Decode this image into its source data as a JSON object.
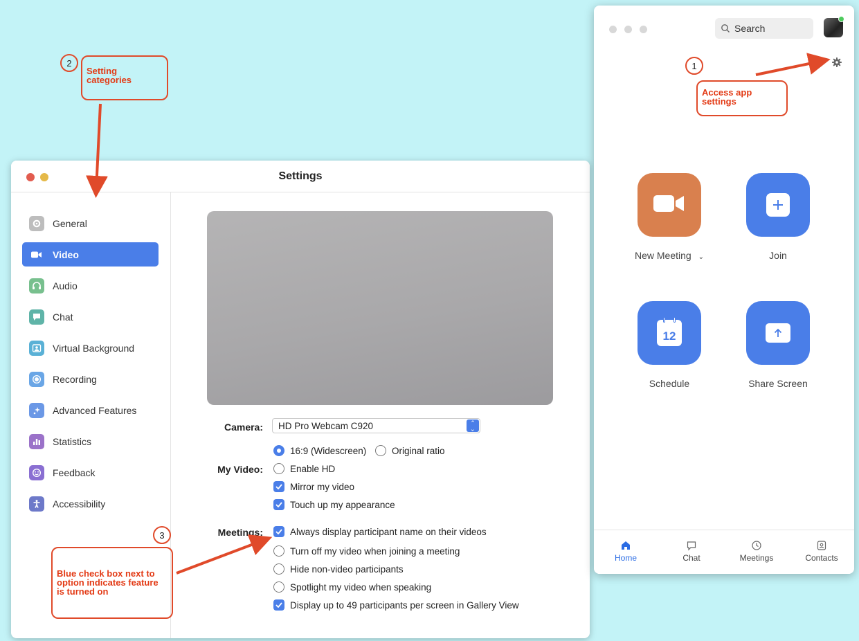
{
  "settings": {
    "title": "Settings",
    "sidebar": [
      {
        "label": "General",
        "icon": "gear-icon",
        "color": "#b9b9b9"
      },
      {
        "label": "Video",
        "icon": "video-camera-icon",
        "color": "#4a7ee8",
        "active": true
      },
      {
        "label": "Audio",
        "icon": "headphones-icon",
        "color": "#73bd8b"
      },
      {
        "label": "Chat",
        "icon": "chat-bubble-icon",
        "color": "#5fb4a8"
      },
      {
        "label": "Virtual Background",
        "icon": "person-background-icon",
        "color": "#5ab1d6"
      },
      {
        "label": "Recording",
        "icon": "record-icon",
        "color": "#6aa6e6"
      },
      {
        "label": "Advanced Features",
        "icon": "sparkle-icon",
        "color": "#6b98e6"
      },
      {
        "label": "Statistics",
        "icon": "bar-chart-icon",
        "color": "#9b72c9"
      },
      {
        "label": "Feedback",
        "icon": "smiley-icon",
        "color": "#8a6fd2"
      },
      {
        "label": "Accessibility",
        "icon": "accessibility-icon",
        "color": "#6d79c9"
      }
    ],
    "camera_label": "Camera:",
    "camera_value": "HD Pro Webcam C920",
    "my_video_label": "My Video:",
    "meetings_label": "Meetings:",
    "ratio": {
      "widescreen": "16:9 (Widescreen)",
      "original": "Original ratio"
    },
    "my_video_options": [
      {
        "label": "Enable HD",
        "checked": false
      },
      {
        "label": "Mirror my video",
        "checked": true
      },
      {
        "label": "Touch up my appearance",
        "checked": true
      }
    ],
    "meetings_options": [
      {
        "label": "Always display participant name on their videos",
        "checked": true
      },
      {
        "label": "Turn off my video when joining a meeting",
        "checked": false
      },
      {
        "label": "Hide non-video participants",
        "checked": false
      },
      {
        "label": "Spotlight my video when speaking",
        "checked": false
      },
      {
        "label": "Display up to 49 participants per screen in Gallery View",
        "checked": true
      }
    ]
  },
  "home": {
    "search_placeholder": "Search",
    "tiles": [
      {
        "label": "New Meeting",
        "icon": "video-camera-icon",
        "color": "#d9804e"
      },
      {
        "label": "Join",
        "icon": "plus-icon",
        "color": "#4a7ee8"
      },
      {
        "label": "Schedule",
        "icon": "calendar-icon",
        "color": "#4a7ee8",
        "day": "12"
      },
      {
        "label": "Share Screen",
        "icon": "share-arrow-icon",
        "color": "#4a7ee8"
      }
    ],
    "nav": [
      {
        "label": "Home",
        "icon": "home-icon",
        "active": true
      },
      {
        "label": "Chat",
        "icon": "chat-bubble-icon"
      },
      {
        "label": "Meetings",
        "icon": "clock-icon"
      },
      {
        "label": "Contacts",
        "icon": "contacts-icon"
      }
    ]
  },
  "annotations": [
    {
      "number": "1",
      "text": "Access app settings"
    },
    {
      "number": "2",
      "text": "Setting categories"
    },
    {
      "number": "3",
      "text": "Blue check box next to option indicates feature is turned on"
    }
  ],
  "colors": {
    "accent": "#4a7ee8",
    "annotation": "#e33a15",
    "background": "#c3f3f7"
  }
}
